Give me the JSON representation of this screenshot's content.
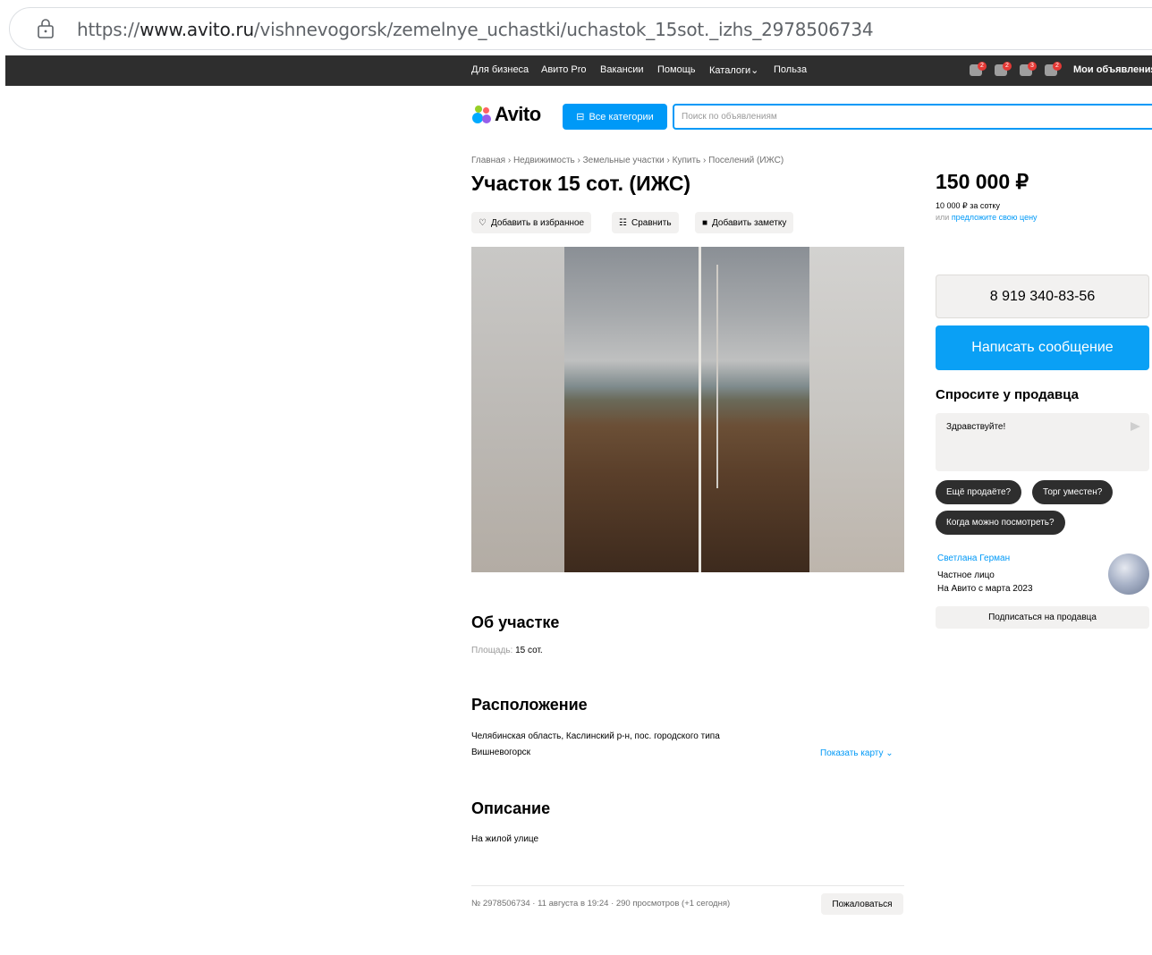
{
  "browser": {
    "url_prefix": "https://",
    "url_domain": "www.avito.ru",
    "url_path": "/vishnevogorsk/zemelnye_uchastki/uchastok_15sot._izhs_2978506734"
  },
  "topnav": {
    "links": [
      "Для бизнеса",
      "Авито Pro",
      "Вакансии",
      "Помощь",
      "Каталоги",
      "Польза"
    ],
    "catalog_suffix": "⌄",
    "badges": [
      "2",
      "2",
      "3",
      "2"
    ],
    "my_ads": "Мои объявления"
  },
  "header": {
    "logo_text": "Avito",
    "all_categories": "Все категории",
    "search_placeholder": "Поиск по объявлениям"
  },
  "breadcrumbs": "Главная › Недвижимость › Земельные участки › Купить › Поселений (ИЖС)",
  "title": "Участок 15 сот. (ИЖС)",
  "actions": {
    "favorite": "Добавить в избранное",
    "compare": "Сравнить",
    "note": "Добавить заметку"
  },
  "about": {
    "heading": "Об участке",
    "area_label": "Площадь:",
    "area_value": "15 сот."
  },
  "location": {
    "heading": "Расположение",
    "line1": "Челябинская область, Каслинский р-н, пос. городского типа",
    "line2": "Вишневогорск",
    "show_map": "Показать карту ⌄"
  },
  "description": {
    "heading": "Описание",
    "text": "На жилой улице"
  },
  "footer": {
    "meta": "№ 2978506734 · 11 августа в 19:24 · 290 просмотров (+1 сегодня)",
    "report": "Пожаловаться"
  },
  "sidebar": {
    "price": "150 000 ₽",
    "per_unit": "10 000 ₽ за сотку",
    "offer_prefix": "или ",
    "offer_link": "предложите свою цену",
    "phone": "8 919 340-83-56",
    "write_message": "Написать сообщение",
    "ask_heading": "Спросите у продавца",
    "ask_text": "Здравствуйте!",
    "chips": [
      "Ещё продаёте?",
      "Торг уместен?",
      "Когда можно посмотреть?"
    ],
    "seller_name": "Светлана Герман",
    "seller_type": "Частное лицо",
    "seller_since": "На Авито с марта 2023",
    "subscribe": "Подписаться на продавца"
  },
  "colors": {
    "accent": "#0099f7",
    "topbar": "#2e2e2e",
    "button_bg": "#f2f1f0"
  }
}
